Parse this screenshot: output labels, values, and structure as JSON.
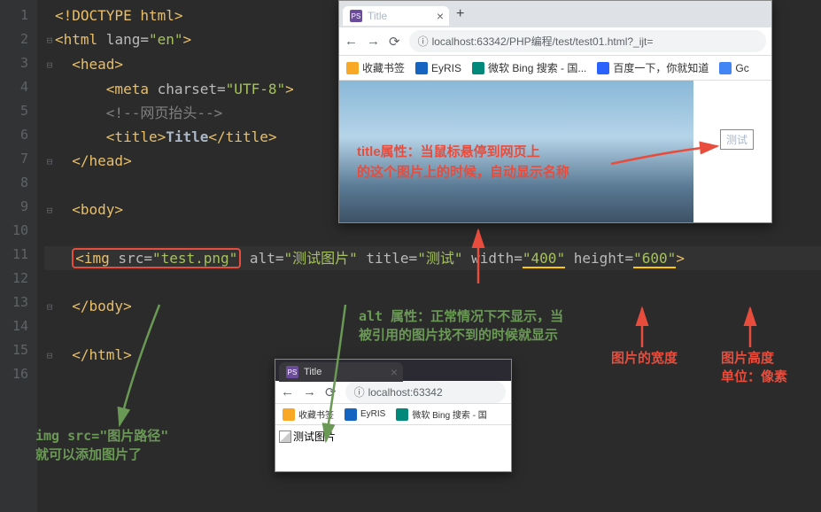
{
  "lines": [
    "1",
    "2",
    "3",
    "4",
    "5",
    "6",
    "7",
    "8",
    "9",
    "10",
    "11",
    "12",
    "13",
    "14",
    "15",
    "16"
  ],
  "code": {
    "l1": "<!DOCTYPE html>",
    "l2_open": "<html",
    "l2_attr": " lang=",
    "l2_val": "\"en\"",
    "l2_close": ">",
    "l3": "<head>",
    "l4_open": "<meta",
    "l4_attr": " charset=",
    "l4_val": "\"UTF-8\"",
    "l4_close": ">",
    "l5": "<!--网页抬头-->",
    "l6_o": "<title>",
    "l6_t": "Title",
    "l6_c": "</title>",
    "l7": "</head>",
    "l9": "<body>",
    "l11_o": "<img",
    "l11_src_a": " src=",
    "l11_src_v": "\"test.png\"",
    "l11_alt_a": " alt=",
    "l11_alt_v": "\"测试图片\"",
    "l11_title_a": " title=",
    "l11_title_v": "\"测试\"",
    "l11_width_a": " width=",
    "l11_width_v": "\"400\"",
    "l11_height_a": " height=",
    "l11_height_v": "\"600\"",
    "l11_c": ">",
    "l13": "</body>",
    "l15": "</html>"
  },
  "browser1": {
    "tab_title": "Title",
    "url_prefix": "localhost:63342/PHP编程/test/test01.html?_ijt=",
    "bookmarks": {
      "b1": "收藏书签",
      "b2": "EyRIS",
      "b3": "微软 Bing 搜索 - 国...",
      "b4": "百度一下，你就知道",
      "b5": "Gc"
    },
    "tooltip": "测试",
    "annotation_l1": "title属性：当鼠标悬停到网页上",
    "annotation_l2": "的这个图片上的时候，自动显示名称"
  },
  "browser2": {
    "tab_title": "Title",
    "url": "localhost:63342",
    "bookmarks": {
      "b1": "收藏书签",
      "b2": "EyRIS",
      "b3": "微软 Bing 搜索 - 国"
    },
    "broken_alt": "测试图片"
  },
  "annotations": {
    "alt_l1": "alt 属性：正常情况下不显示，当",
    "alt_l2": "被引用的图片找不到的时候就显示",
    "width": "图片的宽度",
    "height_l1": "图片高度",
    "height_l2": "单位：像素",
    "imgsrc_l1": "img src=\"图片路径\"",
    "imgsrc_l2": "就可以添加图片了"
  }
}
